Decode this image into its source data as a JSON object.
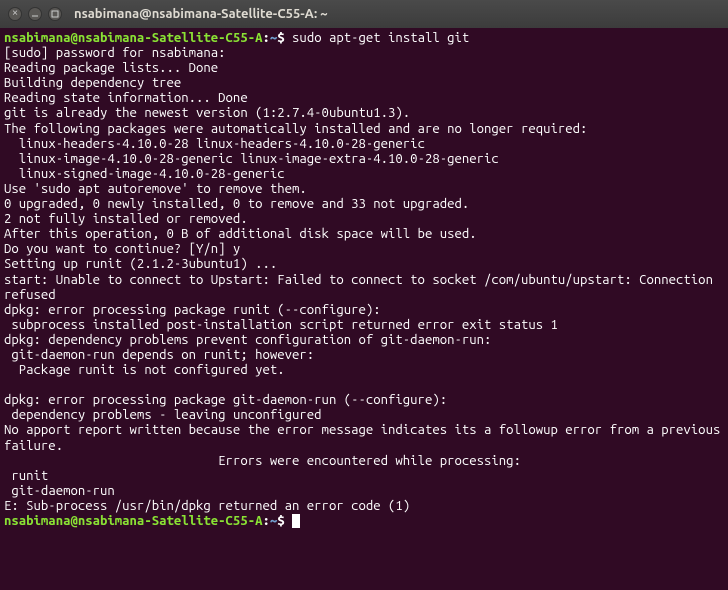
{
  "titlebar": {
    "title": "nsabimana@nsabimana-Satellite-C55-A: ~"
  },
  "prompt": {
    "user_host": "nsabimana@nsabimana-Satellite-C55-A",
    "colon": ":",
    "path": "~",
    "dollar": "$"
  },
  "session": {
    "command": "sudo apt-get install git",
    "lines": [
      "[sudo] password for nsabimana: ",
      "Reading package lists... Done",
      "Building dependency tree       ",
      "Reading state information... Done",
      "git is already the newest version (1:2.7.4-0ubuntu1.3).",
      "The following packages were automatically installed and are no longer required:",
      "  linux-headers-4.10.0-28 linux-headers-4.10.0-28-generic",
      "  linux-image-4.10.0-28-generic linux-image-extra-4.10.0-28-generic",
      "  linux-signed-image-4.10.0-28-generic",
      "Use 'sudo apt autoremove' to remove them.",
      "0 upgraded, 0 newly installed, 0 to remove and 33 not upgraded.",
      "2 not fully installed or removed.",
      "After this operation, 0 B of additional disk space will be used.",
      "Do you want to continue? [Y/n] y",
      "Setting up runit (2.1.2-3ubuntu1) ...",
      "start: Unable to connect to Upstart: Failed to connect to socket /com/ubuntu/upstart: Connection refused",
      "dpkg: error processing package runit (--configure):",
      " subprocess installed post-installation script returned error exit status 1",
      "dpkg: dependency problems prevent configuration of git-daemon-run:",
      " git-daemon-run depends on runit; however:",
      "  Package runit is not configured yet.",
      "",
      "dpkg: error processing package git-daemon-run (--configure):",
      " dependency problems - leaving unconfigured",
      "No apport report written because the error message indicates its a followup error from a previous failure.",
      "                             Errors were encountered while processing:",
      " runit",
      " git-daemon-run",
      "E: Sub-process /usr/bin/dpkg returned an error code (1)"
    ]
  }
}
